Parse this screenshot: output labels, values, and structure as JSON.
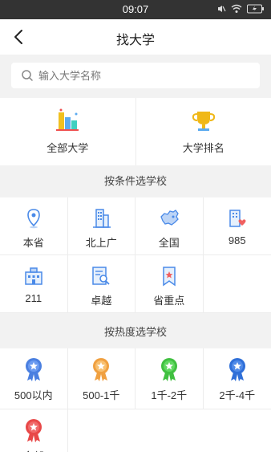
{
  "status": {
    "time": "09:07"
  },
  "nav": {
    "title": "找大学"
  },
  "search": {
    "placeholder": "输入大学名称"
  },
  "top_categories": [
    {
      "label": "全部大学",
      "icon": "all-universities-icon"
    },
    {
      "label": "大学排名",
      "icon": "trophy-icon"
    }
  ],
  "section_condition": {
    "title": "按条件选学校"
  },
  "conditions": [
    {
      "label": "本省",
      "icon": "location-pin-icon"
    },
    {
      "label": "北上广",
      "icon": "city-buildings-icon"
    },
    {
      "label": "全国",
      "icon": "china-map-icon"
    },
    {
      "label": "985",
      "icon": "building-heart-icon"
    },
    {
      "label": "211",
      "icon": "school-building-icon"
    },
    {
      "label": "卓越",
      "icon": "magnifier-document-icon"
    },
    {
      "label": "省重点",
      "icon": "bookmark-star-icon"
    }
  ],
  "section_popularity": {
    "title": "按热度选学校"
  },
  "popularity": [
    {
      "label": "500以内",
      "icon": "medal-blue-icon",
      "color": "#4a7fe0"
    },
    {
      "label": "500-1千",
      "icon": "medal-orange-icon",
      "color": "#f0a040"
    },
    {
      "label": "1千-2千",
      "icon": "medal-green-icon",
      "color": "#40c040"
    },
    {
      "label": "2千-4千",
      "icon": "medal-darkblue-icon",
      "color": "#2f6fd8"
    },
    {
      "label": "全部",
      "icon": "medal-red-icon",
      "color": "#e84848"
    }
  ]
}
